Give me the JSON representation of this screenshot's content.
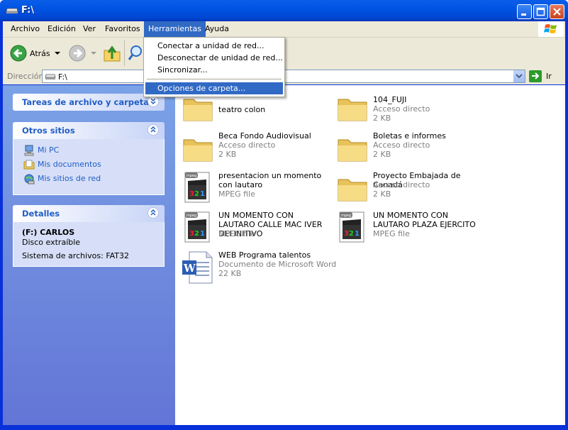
{
  "window": {
    "title": "F:\\"
  },
  "menubar": {
    "items": [
      "Archivo",
      "Edición",
      "Ver",
      "Favoritos",
      "Herramientas",
      "Ayuda"
    ],
    "active": "Herramientas"
  },
  "toolbar": {
    "back_label": "Atrás"
  },
  "address": {
    "label": "Dirección",
    "value": "F:\\",
    "go_label": "Ir"
  },
  "tools_menu": {
    "items": [
      "Conectar a unidad de red...",
      "Desconectar de unidad de red...",
      "Sincronizar...",
      "Opciones de carpeta..."
    ],
    "highlighted": "Opciones de carpeta..."
  },
  "left_panel": {
    "tasks": {
      "title": "Tareas de archivo y carpeta"
    },
    "other": {
      "title": "Otros sitios",
      "links": [
        "Mi PC",
        "Mis documentos",
        "Mis sitios de red"
      ]
    },
    "details": {
      "title": "Detalles",
      "name": "(F:) CARLOS",
      "type": "Disco extraíble",
      "fs": "Sistema de archivos: FAT32"
    }
  },
  "files": [
    {
      "name": "teatro colon",
      "icon": "folder-icon"
    },
    {
      "name": "104_FUJI",
      "type": "Acceso directo",
      "size": "2 KB",
      "icon": "folder-icon"
    },
    {
      "name": "Beca Fondo Audiovisual",
      "type": "Acceso directo",
      "size": "2 KB",
      "icon": "folder-icon"
    },
    {
      "name": "Boletas e informes",
      "type": "Acceso directo",
      "size": "2 KB",
      "icon": "folder-icon"
    },
    {
      "name": "presentacion un momento con lautaro",
      "type": "MPEG file",
      "icon": "mpeg-icon"
    },
    {
      "name": "Proyecto Embajada de Canadá",
      "type": "Acceso directo",
      "size": "2 KB",
      "icon": "folder-icon"
    },
    {
      "name": "UN MOMENTO CON LAUTARO CALLE MAC IVER DEFINITIVO",
      "type": "MPEG file",
      "icon": "mpeg-icon"
    },
    {
      "name": "UN MOMENTO CON LAUTARO PLAZA EJERCITO",
      "type": "MPEG file",
      "icon": "mpeg-icon"
    },
    {
      "name": "WEB Programa talentos",
      "type": "Documento de Microsoft Word",
      "size": "22 KB",
      "icon": "word-doc-icon"
    }
  ]
}
